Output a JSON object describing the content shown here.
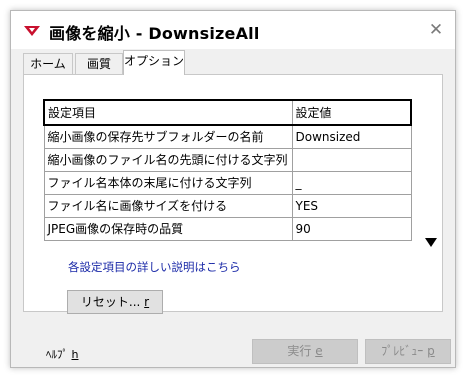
{
  "window": {
    "title": "画像を縮小 - DownsizeAll",
    "close_glyph": "✕",
    "accent_color": "#c8102e"
  },
  "tabs": [
    {
      "label": "ホーム"
    },
    {
      "label": "画質"
    },
    {
      "label": "オプション",
      "active": true
    }
  ],
  "table": {
    "headers": [
      "設定項目",
      "設定値"
    ],
    "rows": [
      {
        "label": "縮小画像の保存先サブフォルダーの名前",
        "value": "Downsized"
      },
      {
        "label": "縮小画像のファイル名の先頭に付ける文字列",
        "value": ""
      },
      {
        "label": "ファイル名本体の末尾に付ける文字列",
        "value": "_"
      },
      {
        "label": "ファイル名に画像サイズを付ける",
        "value": "YES"
      },
      {
        "label": "JPEG画像の保存時の品質",
        "value": "90"
      }
    ]
  },
  "help_link": "各設定項目の詳しい説明はこちら",
  "reset_button": {
    "label": "リセット...",
    "key": "r"
  },
  "footer": {
    "help_label": "ﾍﾙﾌﾟ",
    "help_key": "h",
    "run_label": "実行",
    "run_key": "e",
    "preview_label": "ﾌﾟﾚﾋﾞｭｰ",
    "preview_key": "p"
  },
  "icons": {
    "app": "downsize-app-icon",
    "close": "close-icon",
    "scroll": "scroll-down-arrow-icon"
  }
}
